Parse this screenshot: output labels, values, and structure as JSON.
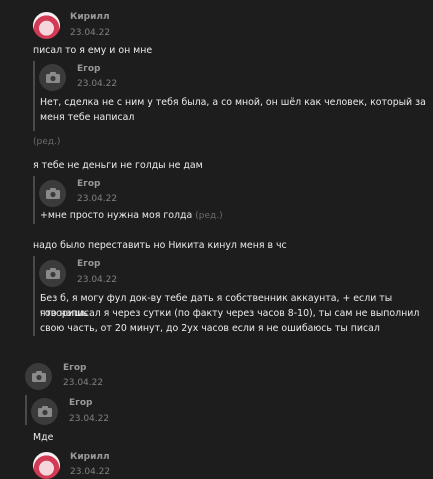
{
  "icons": {
    "camera": "camera-icon",
    "avatar_kirill": "anime-avatar"
  },
  "colors": {
    "background": "#1d1d1d",
    "quote_bar": "#4a4a4a",
    "avatar_placeholder": "#3b3b3b",
    "text": "#ececec"
  },
  "messages": {
    "m1": {
      "author": "Кирилл",
      "date": "23.04.22",
      "text": "писал то я ему и он мне"
    },
    "q1": {
      "author": "Егор",
      "date": "23.04.22",
      "text_line1": "Нет, сделка не с ним у тебя была, а со мной, он шёл как человек, который за",
      "text_line2": "меня тебе написал",
      "edited": "(ред.)"
    },
    "m2": {
      "text": "я тебе не деньги не голды не дам"
    },
    "q2": {
      "author": "Егор",
      "date": "23.04.22",
      "text": "+мне просто нужна моя голда",
      "edited": "(ред.)"
    },
    "m3": {
      "text": "надо было переставить но Никита кинул меня в чс"
    },
    "q3": {
      "author": "Егор",
      "date": "23.04.22",
      "text_line1": "Без б, я могу фул док-ву тебе дать я собственник аккаунта, + если ты говоришь",
      "text_line2": "что написал я через сутки (по факту через часов 8-10), ты сам не выполнил",
      "text_line3": "свою часть, от 20 минут, до 2ух часов если я не ошибаюсь ты писал"
    },
    "m4": {
      "author": "Егор",
      "date": "23.04.22"
    },
    "q4": {
      "author": "Егор",
      "date": "23.04.22"
    },
    "m5": {
      "text": "Мде"
    },
    "m6": {
      "author": "Кирилл",
      "date": "23.04.22"
    }
  }
}
